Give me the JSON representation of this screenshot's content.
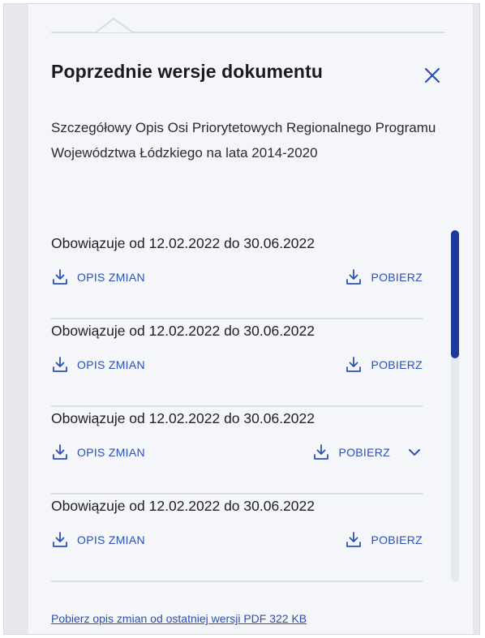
{
  "panel": {
    "title": "Poprzednie wersje dokumentu",
    "close_icon": "close-icon",
    "description": "Szczegółowy Opis Osi Priorytetowych Regionalnego Programu Województwa Łódzkiego na lata 2014-2020"
  },
  "versions": [
    {
      "label": "Obowiązuje od 12.02.2022 do 30.06.2022",
      "changes_label": "OPIS ZMIAN",
      "download_label": "POBIERZ",
      "has_dropdown": false
    },
    {
      "label": "Obowiązuje od 12.02.2022 do 30.06.2022",
      "changes_label": "OPIS ZMIAN",
      "download_label": "POBIERZ",
      "has_dropdown": false
    },
    {
      "label": "Obowiązuje od 12.02.2022 do 30.06.2022",
      "changes_label": "OPIS ZMIAN",
      "download_label": "POBIERZ",
      "has_dropdown": true
    },
    {
      "label": "Obowiązuje od 12.02.2022 do 30.06.2022",
      "changes_label": "OPIS ZMIAN",
      "download_label": "POBIERZ",
      "has_dropdown": false
    }
  ],
  "footer": {
    "link": "Pobierz opis zmian od ostatniej wersji PDF 322 KB"
  },
  "colors": {
    "accent": "#2a4fb8",
    "scroll_thumb": "#1c3a9e",
    "panel_bg": "#f5f6f9"
  }
}
